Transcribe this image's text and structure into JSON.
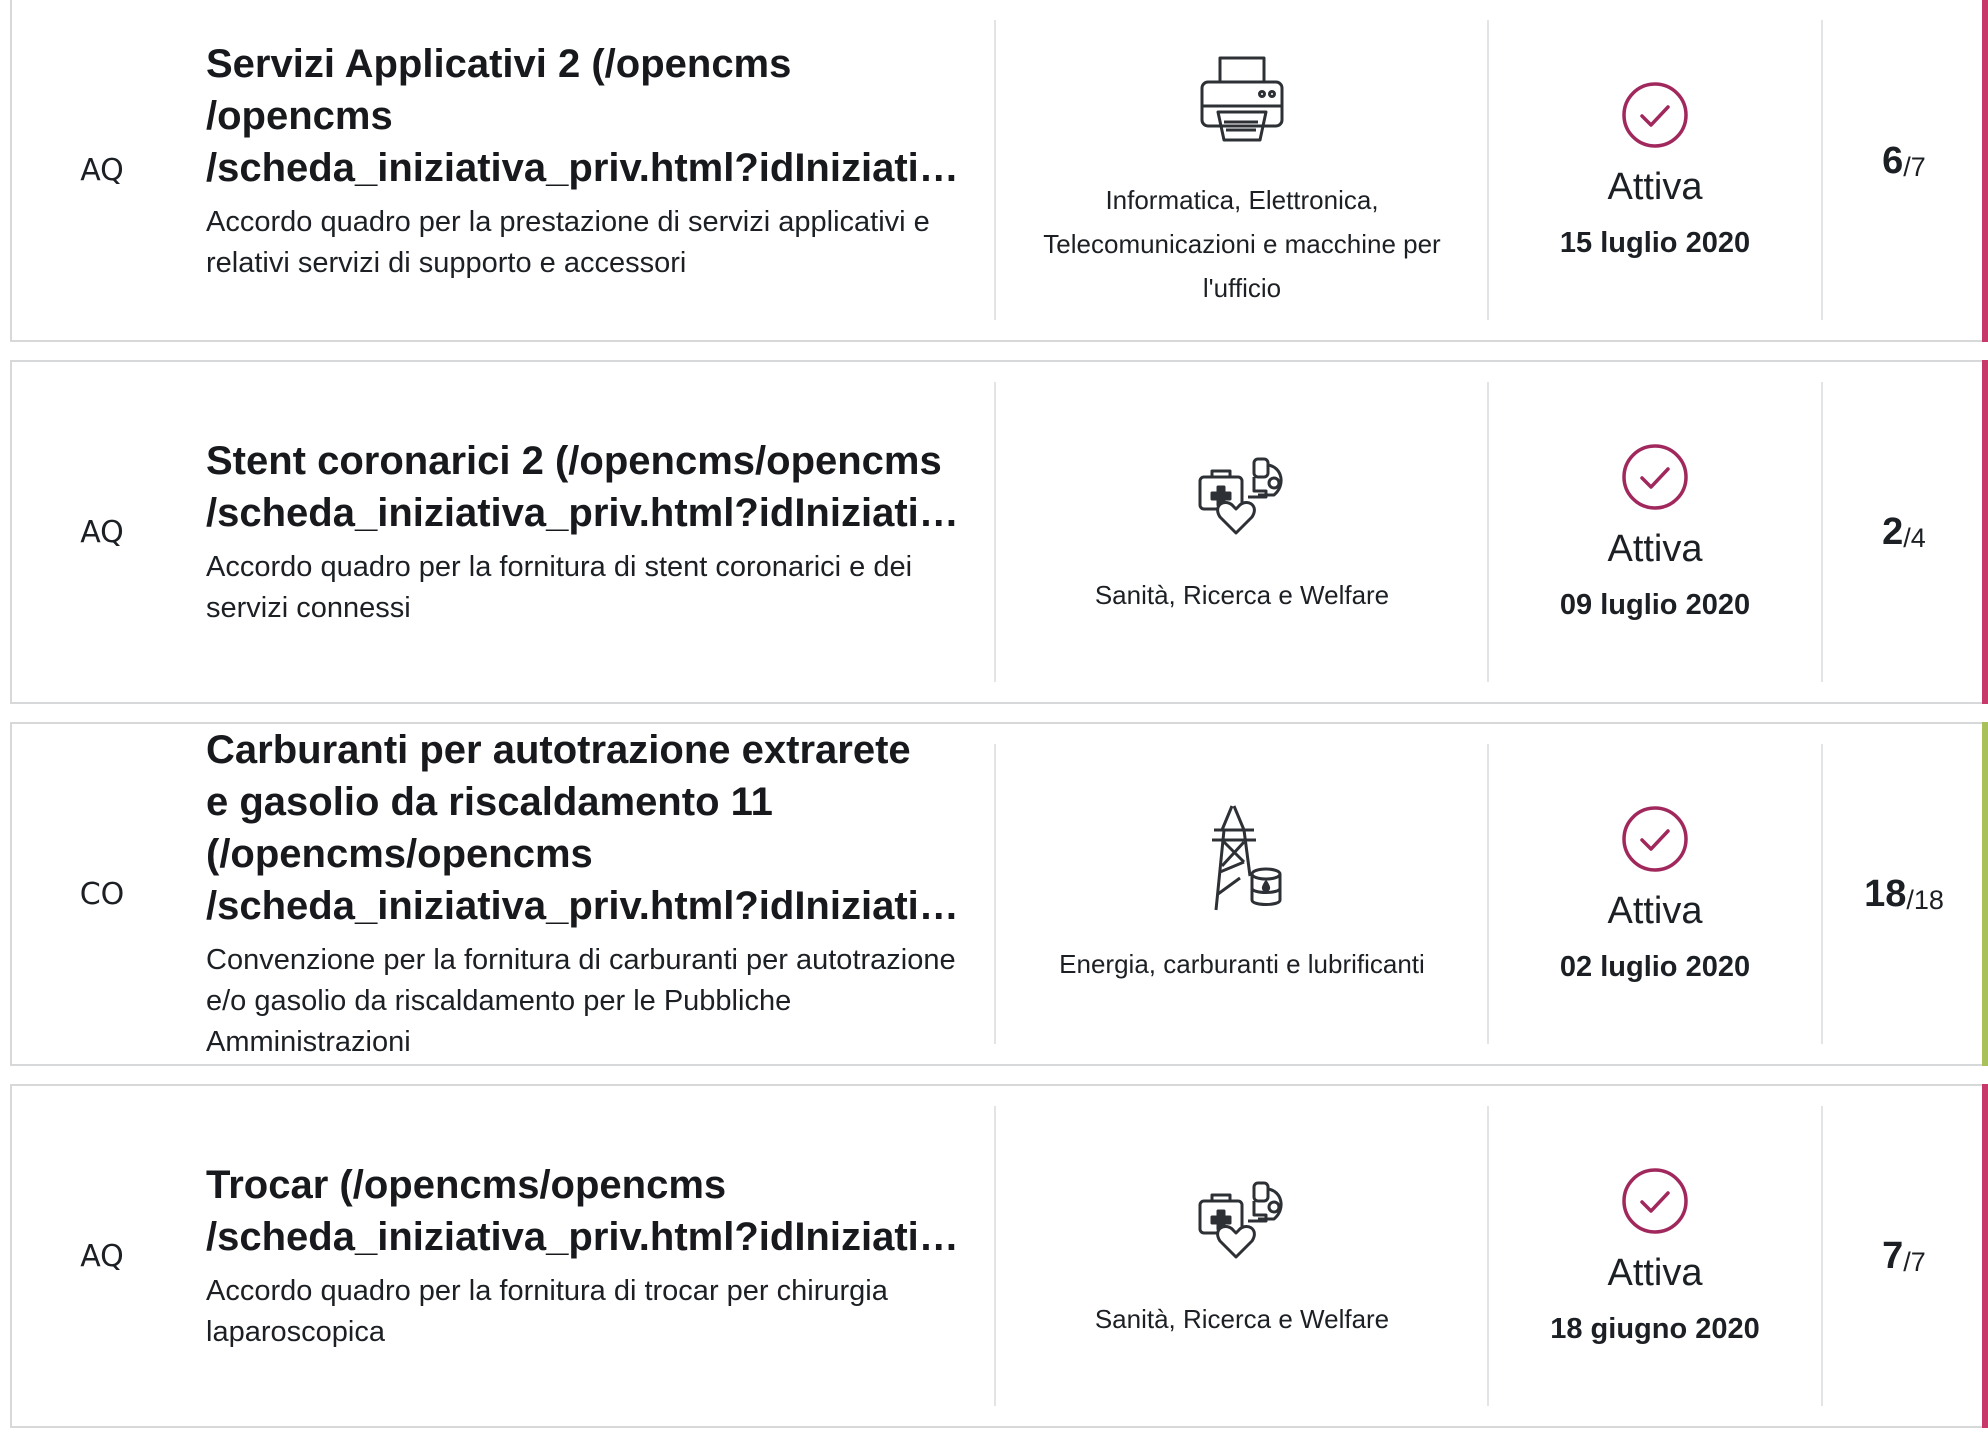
{
  "colors": {
    "pink_accent": "#c8396b",
    "green_accent": "#a9c15a",
    "status_check": "#a1285c",
    "border": "#d6d8da",
    "icon_stroke": "#2d3035"
  },
  "rows": [
    {
      "type": "AQ",
      "title": "Servizi Applicativi 2  (/opencms /opencms /scheda_iniziativa_priv.html?idIniziati…",
      "title_lines": [
        "Servizi Applicativi 2  (/opencms",
        "/opencms",
        "/scheda_iniziativa_priv.html?idIniziati…"
      ],
      "description": "Accordo quadro per la prestazione di servizi applicativi e relativi servizi di supporto e accessori",
      "category_icon": "printer-icon",
      "category": "Informatica, Elettronica, Telecomunicazioni e macchine per l'ufficio",
      "status_icon": "check-circle-icon",
      "status": "Attiva",
      "date": "15 luglio 2020",
      "count_current": "6",
      "count_total": "/7",
      "accent": "pink"
    },
    {
      "type": "AQ",
      "title": "Stent coronarici 2  (/opencms/opencms /scheda_iniziativa_priv.html?idIniziati…",
      "title_lines": [
        "Stent coronarici 2  (/opencms/opencms",
        "/scheda_iniziativa_priv.html?idIniziati…"
      ],
      "description": "Accordo quadro per la fornitura di stent coronarici e dei servizi connessi",
      "category_icon": "health-icon",
      "category": "Sanità, Ricerca e Welfare",
      "status_icon": "check-circle-icon",
      "status": "Attiva",
      "date": "09 luglio 2020",
      "count_current": "2",
      "count_total": "/4",
      "accent": "pink"
    },
    {
      "type": "CO",
      "title": "Carburanti per autotrazione extrarete e gasolio da riscaldamento 11 (/opencms/opencms /scheda_iniziativa_priv.html?idIniziati…",
      "title_lines": [
        "Carburanti per autotrazione extrarete",
        "e gasolio da riscaldamento 11",
        "(/opencms/opencms",
        "/scheda_iniziativa_priv.html?idIniziati…"
      ],
      "description": "Convenzione per la fornitura di carburanti per autotrazione e/o gasolio da riscaldamento per le Pubbliche Amministrazioni",
      "category_icon": "energy-pylon-icon",
      "category": "Energia, carburanti e lubrificanti",
      "status_icon": "check-circle-icon",
      "status": "Attiva",
      "date": "02 luglio 2020",
      "count_current": "18",
      "count_total": "/18",
      "accent": "green"
    },
    {
      "type": "AQ",
      "title": "Trocar  (/opencms/opencms /scheda_iniziativa_priv.html?idIniziati…",
      "title_lines": [
        "Trocar  (/opencms/opencms",
        "/scheda_iniziativa_priv.html?idIniziati…"
      ],
      "description": "Accordo quadro per la fornitura di trocar per chirurgia laparoscopica",
      "category_icon": "health-icon",
      "category": "Sanità, Ricerca e Welfare",
      "status_icon": "check-circle-icon",
      "status": "Attiva",
      "date": "18 giugno 2020",
      "count_current": "7",
      "count_total": "/7",
      "accent": "pink"
    }
  ]
}
